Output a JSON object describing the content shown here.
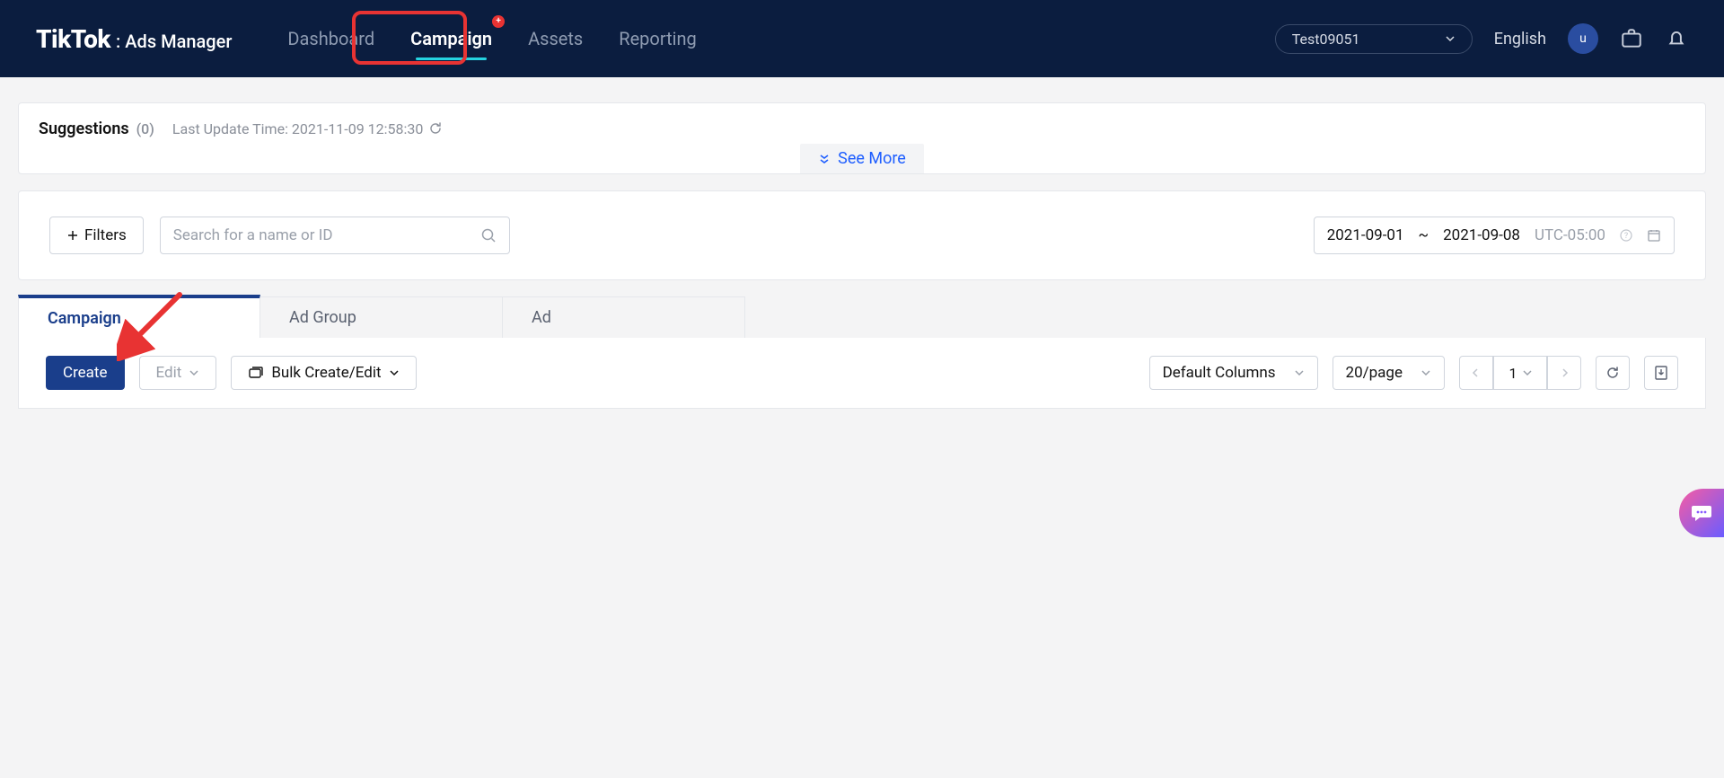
{
  "header": {
    "logo_main": "TikTok",
    "logo_sub": ": Ads Manager",
    "nav": {
      "dashboard": "Dashboard",
      "campaign": "Campaign",
      "assets": "Assets",
      "reporting": "Reporting",
      "campaign_badge": "+"
    },
    "account_name": "Test09051",
    "language": "English",
    "avatar_initial": "u"
  },
  "suggestions": {
    "title": "Suggestions",
    "count": "(0)",
    "last_update_label": "Last Update Time:",
    "last_update_value": "2021-11-09 12:58:30",
    "see_more": "See More"
  },
  "filters": {
    "filters_btn": "Filters",
    "search_placeholder": "Search for a name or ID",
    "date_from": "2021-09-01",
    "date_sep": "~",
    "date_to": "2021-09-08",
    "timezone": "UTC-05:00"
  },
  "tabs": {
    "campaign": "Campaign",
    "ad_group": "Ad Group",
    "ad": "Ad"
  },
  "toolbar": {
    "create": "Create",
    "edit": "Edit",
    "bulk": "Bulk Create/Edit",
    "columns": "Default Columns",
    "page_size": "20/page",
    "page_number": "1"
  }
}
